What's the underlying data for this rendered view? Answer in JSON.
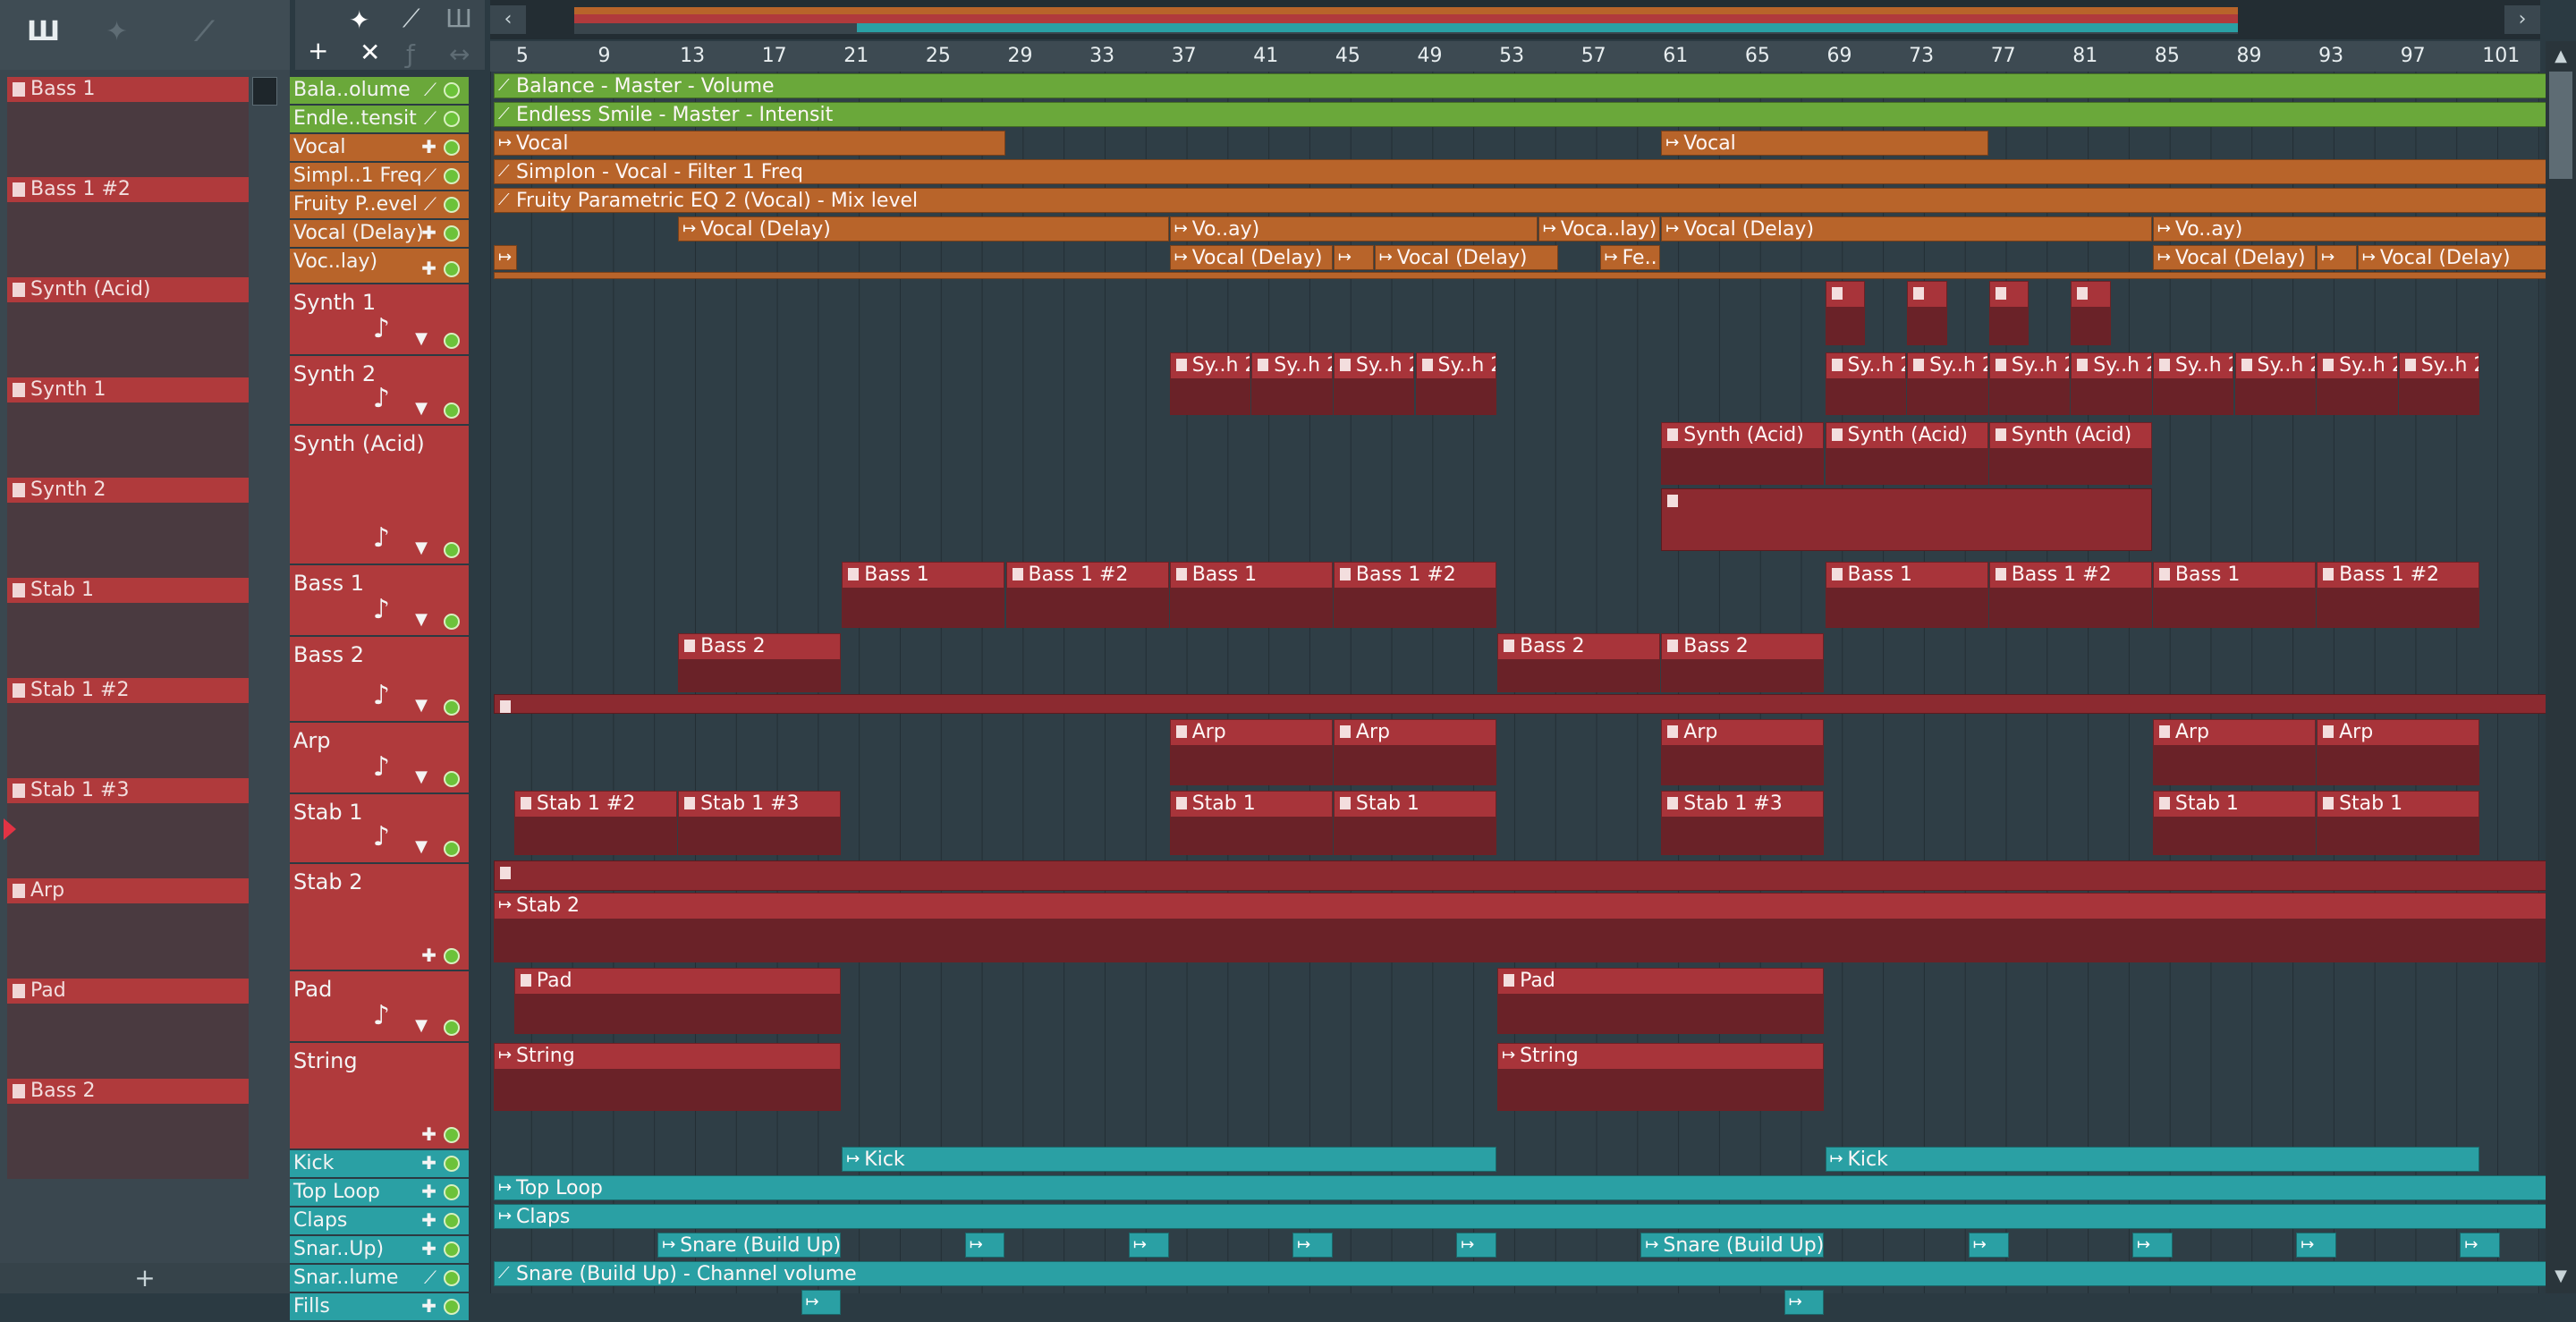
{
  "toolbar": {
    "tool_icons": [
      "piano-keys-icon",
      "wave-icon",
      "automation-icon",
      "piano-icon",
      "add-icon",
      "delete-icon",
      "function-icon",
      "stretch-icon"
    ],
    "add_label": "+",
    "delete_label": "✕"
  },
  "picker": {
    "items": [
      "Bass 1",
      "Bass 1 #2",
      "Synth (Acid)",
      "Synth 1",
      "Synth 2",
      "Stab 1",
      "Stab 1 #2",
      "Stab 1 #3",
      "Arp",
      "Pad",
      "Bass 2"
    ],
    "add_label": "+"
  },
  "ruler": {
    "ticks": [
      "5",
      "9",
      "13",
      "17",
      "21",
      "25",
      "29",
      "33",
      "37",
      "41",
      "45",
      "49",
      "53",
      "57",
      "61",
      "65",
      "69",
      "73",
      "77",
      "81",
      "85",
      "89",
      "93",
      "97",
      "101"
    ]
  },
  "tracks": [
    {
      "name": "Bala..olume",
      "color": "#6aa83a"
    },
    {
      "name": "Endle..tensit",
      "color": "#6aa83a"
    },
    {
      "name": "Vocal",
      "color": "#b8642a"
    },
    {
      "name": "Simpl..1 Freq",
      "color": "#b8642a"
    },
    {
      "name": "Fruity P..evel",
      "color": "#b8642a"
    },
    {
      "name": "Vocal (Delay)",
      "color": "#b8642a"
    },
    {
      "name": "Voc..lay)",
      "color": "#b8642a"
    },
    {
      "name": "Synth 1",
      "color": "#b03a3c"
    },
    {
      "name": "Synth 2",
      "color": "#b03a3c"
    },
    {
      "name": "Synth (Acid)",
      "color": "#b03a3c"
    },
    {
      "name": "Bass 1",
      "color": "#b03a3c"
    },
    {
      "name": "Bass 2",
      "color": "#b03a3c"
    },
    {
      "name": "Arp",
      "color": "#b03a3c"
    },
    {
      "name": "Stab 1",
      "color": "#b03a3c"
    },
    {
      "name": "Stab 2",
      "color": "#b03a3c"
    },
    {
      "name": "Pad",
      "color": "#b03a3c"
    },
    {
      "name": "String",
      "color": "#b03a3c"
    },
    {
      "name": "Kick",
      "color": "#2aa0a4"
    },
    {
      "name": "Top Loop",
      "color": "#2aa0a4"
    },
    {
      "name": "Claps",
      "color": "#2aa0a4"
    },
    {
      "name": "Snar..Up)",
      "color": "#2aa0a4"
    },
    {
      "name": "Snar..lume",
      "color": "#2aa0a4"
    },
    {
      "name": "Fills",
      "color": "#2aa0a4"
    }
  ],
  "clips": {
    "balance": "Balance - Master - Volume",
    "endless": "Endless Smile - Master - Intensit",
    "vocal": "Vocal",
    "simplon": "Simplon - Vocal - Filter 1 Freq",
    "fruity": "Fruity Parametric EQ 2 (Vocal) - Mix level",
    "vocal_delay": "Vocal (Delay)",
    "vo_ay": "Vo..ay)",
    "voca_lay": "Voca..lay)",
    "fe": "Fe..",
    "sy_h2": "Sy..h 2",
    "synth_acid": "Synth (Acid)",
    "bass1": "Bass 1",
    "bass1_2": "Bass 1 #2",
    "bass2": "Bass 2",
    "arp": "Arp",
    "stab1": "Stab 1",
    "stab1_2": "Stab 1 #2",
    "stab1_3": "Stab 1 #3",
    "stab2": "Stab 2",
    "pad": "Pad",
    "string": "String",
    "kick": "Kick",
    "toploop": "Top Loop",
    "claps": "Claps",
    "snare_build": "Snare (Build Up)",
    "snare_vol": "Snare (Build Up) - Channel volume"
  }
}
